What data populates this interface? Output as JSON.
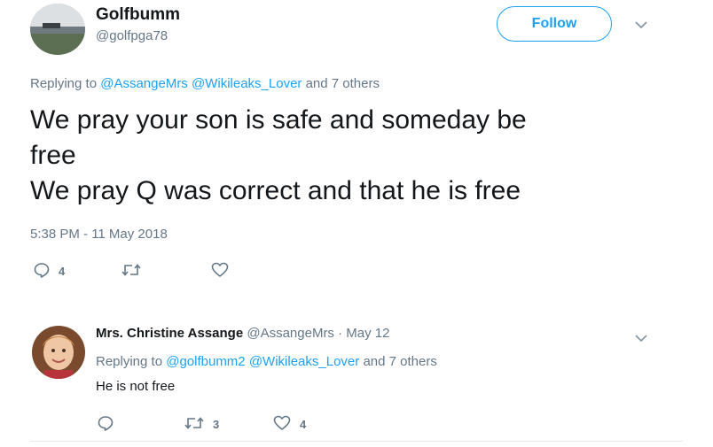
{
  "tweet": {
    "author_name": "Golfbumm",
    "author_handle": "@golfpga78",
    "follow_label": "Follow",
    "replying_prefix": "Replying to",
    "replying_mention_1": "@AssangeMrs",
    "replying_mention_2": "@Wikileaks_Lover",
    "replying_suffix": "and 7 others",
    "text_line_1": "We pray your son is safe and someday be",
    "text_line_2": "free",
    "text_line_3": "We pray Q was correct and that he is free",
    "timestamp": "5:38 PM - 11 May 2018",
    "reply_count": "4",
    "icons": [
      "avatar-photo",
      "chevron-down-icon",
      "reply-icon",
      "retweet-icon",
      "heart-icon"
    ]
  },
  "reply": {
    "author_name": "Mrs. Christine Assange",
    "author_handle": "@AssangeMrs",
    "separator": "·",
    "date": "May 12",
    "replying_prefix": "Replying to",
    "replying_mention_1": "@golfbumm2",
    "replying_mention_2": "@Wikileaks_Lover",
    "replying_suffix": "and 7 others",
    "text": "He is not free",
    "retweet_count": "3",
    "like_count": "4"
  },
  "colors": {
    "accent": "#1da1f2",
    "text": "#14171a",
    "secondary": "#657786",
    "divider": "#e6ecf0"
  }
}
